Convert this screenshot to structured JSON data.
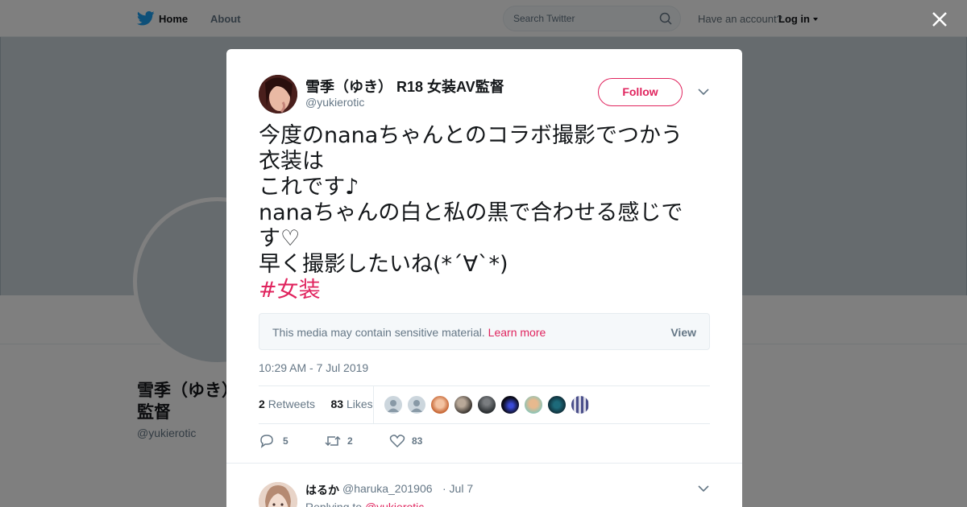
{
  "topbar": {
    "home_label": "Home",
    "about_label": "About",
    "search_placeholder": "Search Twitter",
    "account_prompt": "Have an account?",
    "login_label": "Log in"
  },
  "profile": {
    "name_line1": "雪季（ゆき）",
    "name_line2": "監督",
    "handle": "@yukierotic"
  },
  "tweet": {
    "author_name": "雪季（ゆき） R18 女装AV監督",
    "author_handle": "@yukierotic",
    "follow_label": "Follow",
    "text_lines": [
      "今度のnanaちゃんとのコラボ撮影でつかう",
      "衣装は",
      "これです♪",
      "nanaちゃんの白と私の黒で合わせる感じで",
      "す♡",
      "早く撮影したいね(*´∀`*)"
    ],
    "hashtag": "#女装",
    "sensitive_message": "This media may contain sensitive material.",
    "learn_more_label": "Learn more",
    "view_label": "View",
    "timestamp": "10:29 AM - 7 Jul 2019",
    "retweets_count": "2",
    "retweets_label": "Retweets",
    "likes_count": "83",
    "likes_label": "Likes",
    "reply_count": "5",
    "retweet_action_count": "2",
    "like_action_count": "83"
  },
  "reply": {
    "name": "はるか",
    "handle": "@haruka_201906",
    "time": "· Jul 7",
    "replying_to_label": "Replying to",
    "replying_to_handle": "@yukierotic"
  },
  "colors": {
    "accent": "#e0245e",
    "twitter_blue": "#1da1f2",
    "muted": "#657786"
  },
  "likers": [
    "default-avatar",
    "default-avatar",
    "orange-avatar",
    "dark-avatar",
    "portrait-avatar",
    "night-avatar",
    "face-avatar",
    "teal-avatar",
    "pattern-avatar"
  ]
}
